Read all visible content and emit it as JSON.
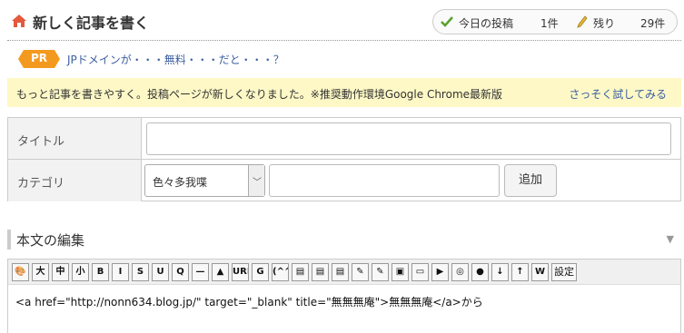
{
  "header": {
    "title": "新しく記事を書く",
    "today_posts_label": "今日の投稿",
    "today_posts_count": "1件",
    "remaining_label": "残り",
    "remaining_count": "29件"
  },
  "pr": {
    "badge": "PR",
    "link_text": "JPドメインが・・・無料・・・だと・・・？"
  },
  "notice": {
    "text": "もっと記事を書きやすく。投稿ページが新しくなりました。※推奨動作環境Google Chrome最新版",
    "link_text": "さっそく試してみる"
  },
  "form": {
    "title_label": "タイトル",
    "title_value": "",
    "category_label": "カテゴリ",
    "category_selected": "色々多我喋",
    "category_new_value": "",
    "add_button_label": "追加"
  },
  "body_section": {
    "title": "本文の編集",
    "content": "<a href=\"http://nonn634.blog.jp/\" target=\"_blank\" title=\"無無無庵\">無無無庵</a>から"
  },
  "toolbar": {
    "buttons": [
      "🎨",
      "大",
      "中",
      "小",
      "B",
      "I",
      "S",
      "U",
      "Q",
      "—",
      "▲",
      "URL",
      "G",
      "(^^)",
      "▤",
      "▤",
      "▤",
      "✎",
      "✎",
      "▣",
      "▭",
      "▶",
      "◎",
      "●",
      "↓",
      "↑",
      "W"
    ],
    "settings_label": "設定"
  },
  "colors": {
    "pr_badge": "#f39a1e",
    "link": "#3b5fa0",
    "notice_bg": "#fdf8c6",
    "label_bg": "#f2f2f2"
  }
}
